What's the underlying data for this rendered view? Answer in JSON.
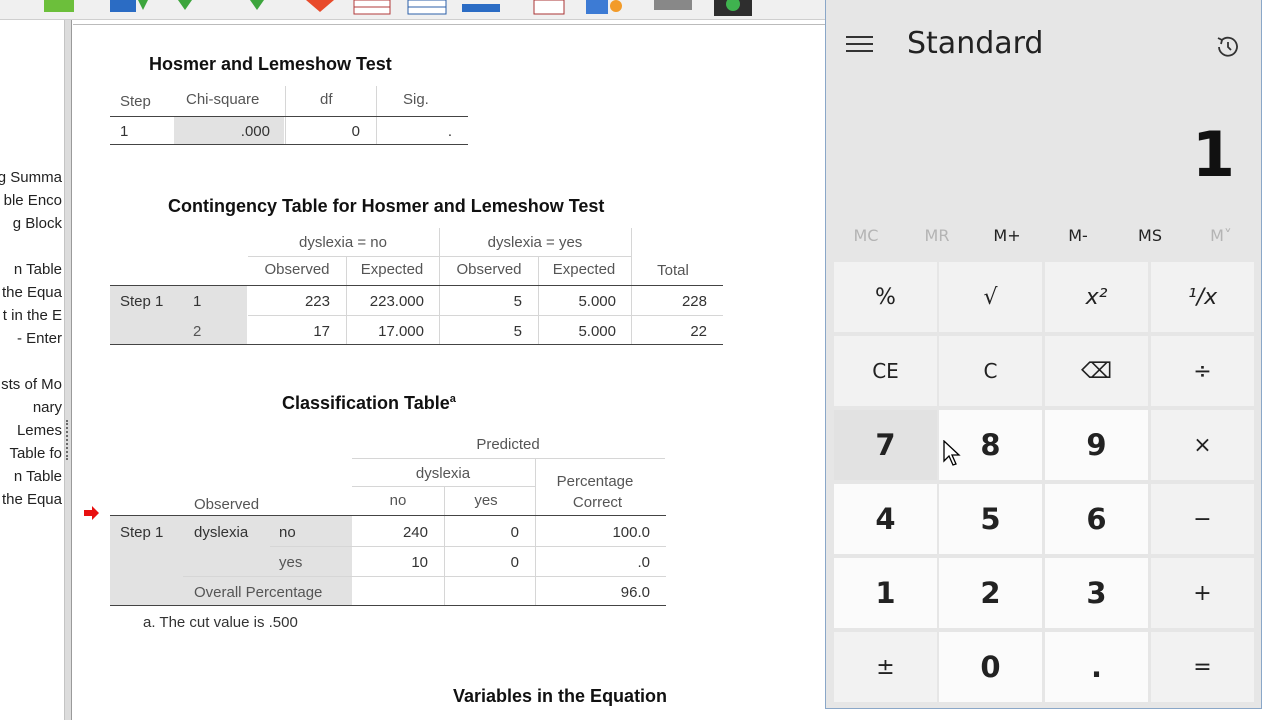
{
  "hosmer": {
    "title": "Hosmer and Lemeshow Test",
    "headers": [
      "Step",
      "Chi-square",
      "df",
      "Sig."
    ],
    "row": {
      "step": "1",
      "chi_square": ".000",
      "df": "0",
      "sig": "."
    }
  },
  "contingency": {
    "title": "Contingency Table for Hosmer and Lemeshow Test",
    "group_no": "dyslexia = no",
    "group_yes": "dyslexia = yes",
    "headers": [
      "Observed",
      "Expected",
      "Observed",
      "Expected",
      "Total"
    ],
    "step_label": "Step 1",
    "rows": [
      [
        "1",
        "223",
        "223.000",
        "5",
        "5.000",
        "228"
      ],
      [
        "2",
        "17",
        "17.000",
        "5",
        "5.000",
        "22"
      ]
    ]
  },
  "classification": {
    "title": "Classification Table",
    "superscript": "a",
    "predicted": "Predicted",
    "dyslexia": "dyslexia",
    "observed": "Observed",
    "col_no": "no",
    "col_yes": "yes",
    "pct_line1": "Percentage",
    "pct_line2": "Correct",
    "step_label": "Step 1",
    "var_label": "dyslexia",
    "rows": [
      [
        "no",
        "240",
        "0",
        "100.0"
      ],
      [
        "yes",
        "10",
        "0",
        ".0"
      ]
    ],
    "overall_label": "Overall Percentage",
    "overall_value": "96.0",
    "footnote": "a. The cut value is .500"
  },
  "variables_title": "Variables in the Equation",
  "outline": [
    "g Summa",
    "ble Enco",
    "g Block",
    "n Table",
    "the Equa",
    "t in the E",
    "- Enter",
    "sts of Mo",
    "nary",
    "Lemes",
    "Table fo",
    "n Table",
    "the Equa"
  ],
  "calculator": {
    "mode": "Standard",
    "display": "1",
    "memory": [
      "MC",
      "MR",
      "M+",
      "M-",
      "MS",
      "M˅"
    ],
    "keys": [
      [
        "%",
        "√",
        "x²",
        "¹/x"
      ],
      [
        "CE",
        "C",
        "⌫",
        "÷"
      ],
      [
        "7",
        "8",
        "9",
        "×"
      ],
      [
        "4",
        "5",
        "6",
        "−"
      ],
      [
        "1",
        "2",
        "3",
        "+"
      ],
      [
        "±",
        "0",
        ".",
        "="
      ]
    ]
  },
  "colors": {
    "accent_border": "#8aa7c8",
    "arrow": "#e81010",
    "shade": "#e2e2e2"
  }
}
